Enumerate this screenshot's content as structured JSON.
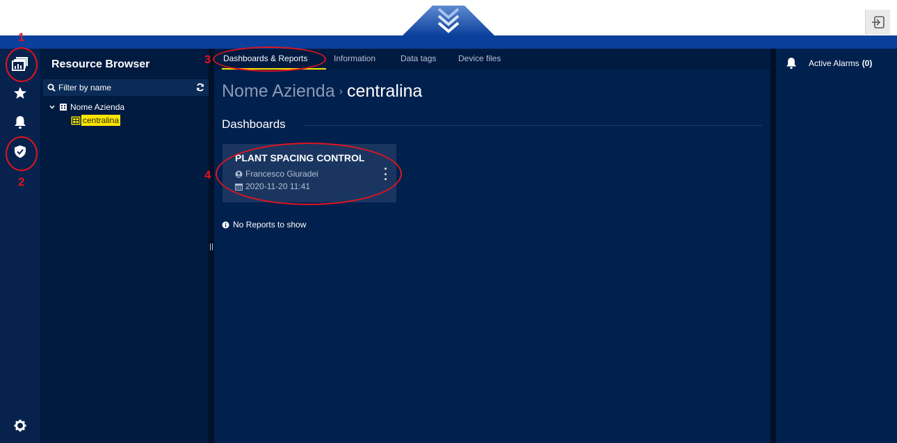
{
  "topbar": {
    "logout_icon": "logout-icon",
    "collapse_icon": "double-chevron-down-icon"
  },
  "rail": {
    "items": [
      {
        "icon": "resource-browser-icon"
      },
      {
        "icon": "star-icon"
      },
      {
        "icon": "bell-icon"
      },
      {
        "icon": "shield-check-icon"
      }
    ],
    "settings_icon": "gear-icon"
  },
  "browser": {
    "title": "Resource Browser",
    "filter_placeholder": "Filter by name",
    "tree": {
      "root": "Nome Azienda",
      "child": "centralina"
    }
  },
  "main": {
    "tabs": [
      {
        "label": "Dashboards & Reports",
        "active": true
      },
      {
        "label": "Information",
        "active": false
      },
      {
        "label": "Data tags",
        "active": false
      },
      {
        "label": "Device files",
        "active": false
      }
    ],
    "breadcrumb": {
      "parent": "Nome Azienda",
      "separator": "›",
      "current": "centralina"
    },
    "dashboards_heading": "Dashboards",
    "dashboard": {
      "title": "PLANT SPACING CONTROL",
      "author": "Francesco Giuradei",
      "date": "2020-11-20 11:41"
    },
    "no_reports": "No Reports to show"
  },
  "alarms": {
    "label": "Active Alarms",
    "count": "(0)"
  },
  "annotations": [
    "1",
    "2",
    "3",
    "4"
  ],
  "colors": {
    "navy": "#00204d",
    "accent_blue": "#0a3f9c",
    "highlight": "#ffe600",
    "annotation_red": "#e0141e"
  }
}
